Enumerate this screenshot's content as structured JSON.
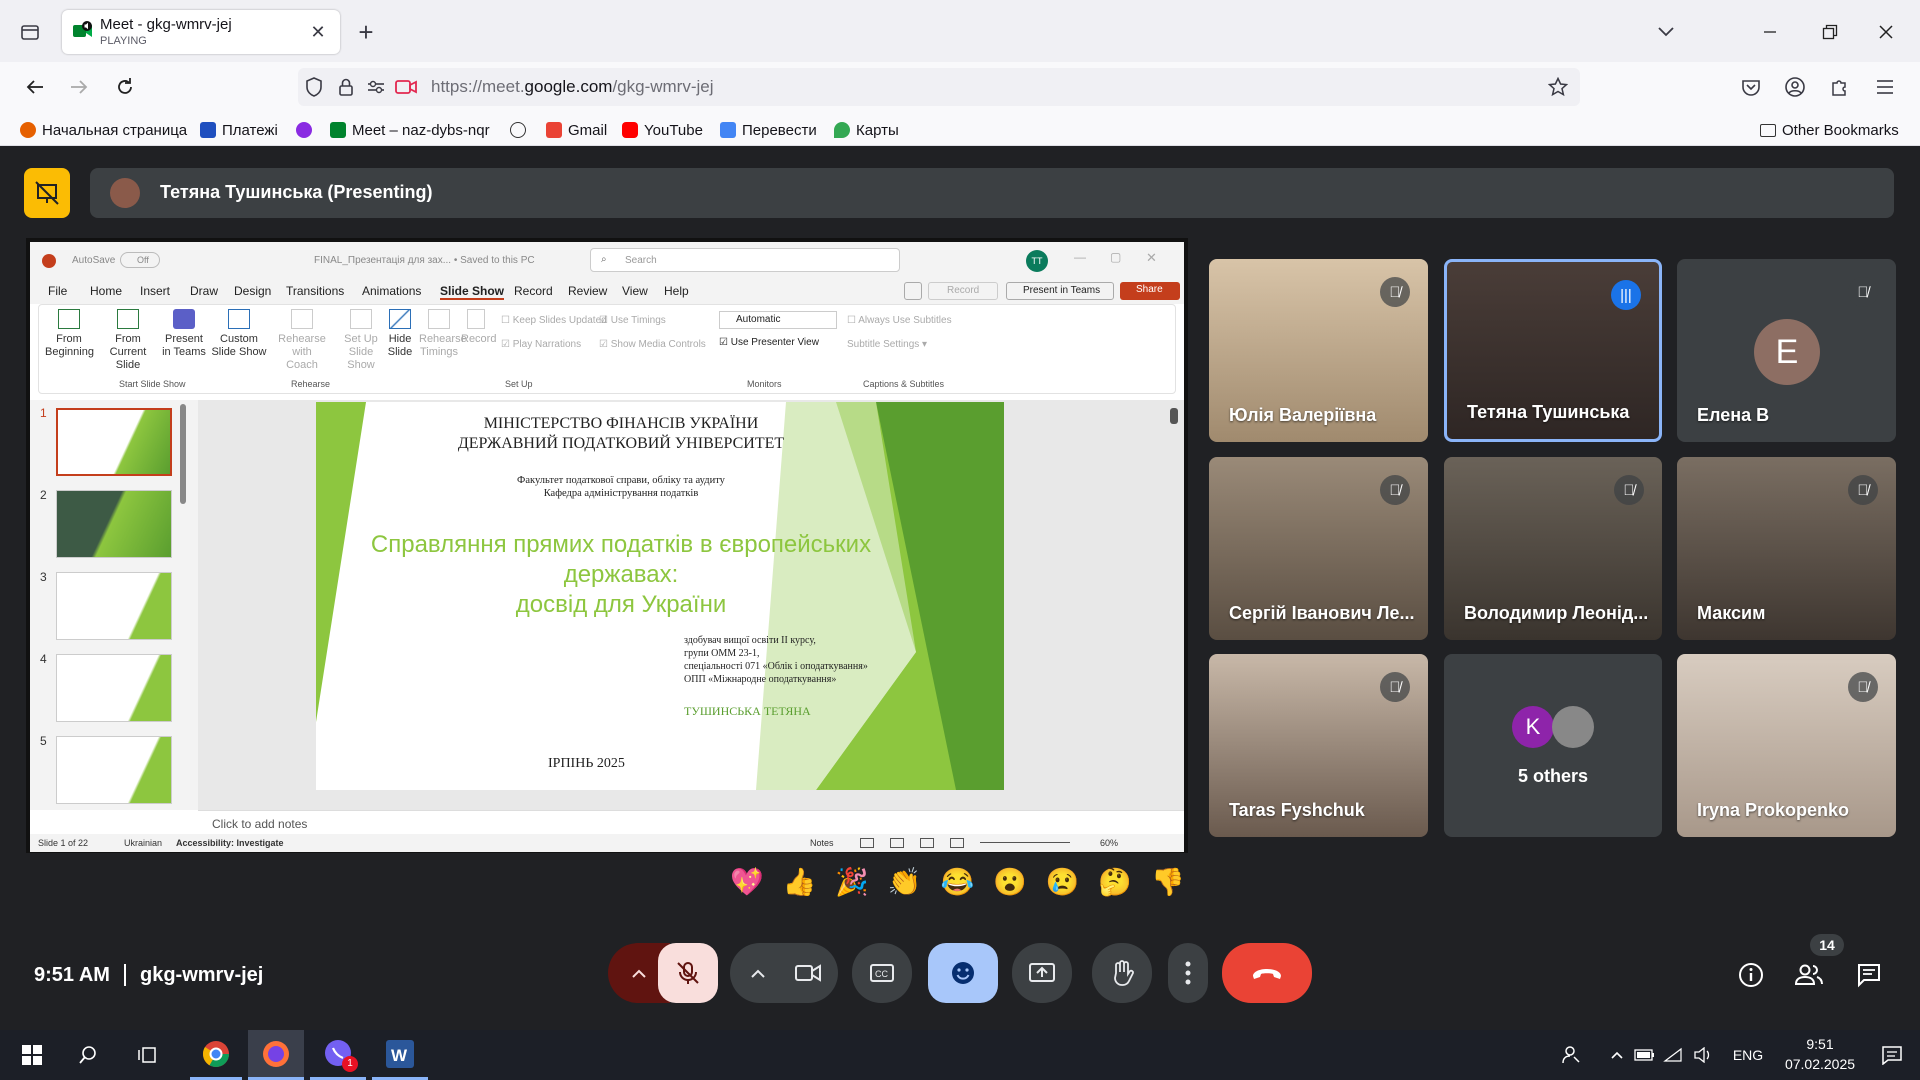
{
  "browser": {
    "tab": {
      "title": "Meet - gkg-wmrv-jej",
      "subtitle": "PLAYING"
    },
    "url": {
      "prefix": "https://meet.",
      "domain": "google.com",
      "path": "/gkg-wmrv-jej"
    },
    "bookmarks": [
      {
        "label": "Начальная страница",
        "color": "#e66000"
      },
      {
        "label": "Платежі",
        "color": "#1f4fbf"
      },
      {
        "label": "Meet – naz-dybs-nqr",
        "color": "#00832d"
      },
      {
        "label": "Gmail",
        "color": "#ea4335"
      },
      {
        "label": "YouTube",
        "color": "#ff0000"
      },
      {
        "label": "Перевести",
        "color": "#4285f4"
      },
      {
        "label": "Карты",
        "color": "#34a853"
      }
    ],
    "other_bookmarks": "Other Bookmarks"
  },
  "meet": {
    "presenter_label": "Тетяна Тушинська (Presenting)",
    "participants": [
      {
        "name": "Юлія Валеріївна",
        "muted": true,
        "bg": "#b8a48c"
      },
      {
        "name": "Тетяна Тушинська",
        "muted": false,
        "speaking": true,
        "bg": "#3a3330"
      },
      {
        "name": "Елена В",
        "muted": true,
        "avatar": "E",
        "bg": "#3c4043",
        "avatar_color": "#8d6e63"
      },
      {
        "name": "Сергій Іванович Ле...",
        "muted": true,
        "bg": "#8a7a6a"
      },
      {
        "name": "Володимир Леонід...",
        "muted": true,
        "bg": "#5a5248"
      },
      {
        "name": "Максим",
        "muted": true,
        "bg": "#6b5e54"
      },
      {
        "name": "Taras Fyshchuk",
        "muted": true,
        "bg": "#7a6a5e"
      },
      {
        "name": "5 others",
        "avatar": "K",
        "bg": "#3c4043",
        "avatar_color": "#8e24aa"
      },
      {
        "name": "Iryna Prokopenko",
        "muted": true,
        "bg": "#a89888"
      }
    ],
    "emojis": [
      "💖",
      "👍",
      "🎉",
      "👏",
      "😂",
      "😮",
      "😢",
      "🤔",
      "👎"
    ],
    "time": "9:51 AM",
    "meeting_code": "gkg-wmrv-jej",
    "people_count": "14",
    "colors": {
      "accent": "#8ab4f8",
      "hangup": "#ea4335",
      "mic_off": "#f9dedc",
      "present_badge": "#fbbc04"
    }
  },
  "ppt": {
    "autosave": "AutoSave",
    "autosave_state": "Off",
    "file_title": "FINAL_Презентація для зах... • Saved to this PC",
    "search": "Search",
    "user_initials": "TT",
    "tabs": [
      "File",
      "Home",
      "Insert",
      "Draw",
      "Design",
      "Transitions",
      "Animations",
      "Slide Show",
      "Record",
      "Review",
      "View",
      "Help"
    ],
    "record_btn": "Record",
    "present_teams": "Present in Teams",
    "share": "Share",
    "ribbon": {
      "from_beginning": "From Beginning",
      "from_current": "From Current Slide",
      "present_teams": "Present in Teams",
      "custom_show": "Custom Slide Show",
      "rehearse_coach": "Rehearse with Coach",
      "setup_show": "Set Up Slide Show",
      "hide_slide": "Hide Slide",
      "rehearse_timings": "Rehearse Timings",
      "record": "Record",
      "keep_updated": "Keep Slides Updated",
      "use_timings": "Use Timings",
      "play_narrations": "Play Narrations",
      "show_media": "Show Media Controls",
      "monitor": "Automatic",
      "presenter_view": "Use Presenter View",
      "always_subtitles": "Always Use Subtitles",
      "subtitle_settings": "Subtitle Settings",
      "groups": [
        "Start Slide Show",
        "Rehearse",
        "Set Up",
        "Monitors",
        "Captions & Subtitles"
      ]
    },
    "slide_numbers": [
      "1",
      "2",
      "3",
      "4",
      "5"
    ],
    "slide": {
      "line1": "МІНІСТЕРСТВО ФІНАНСІВ УКРАЇНИ",
      "line2": "ДЕРЖАВНИЙ ПОДАТКОВИЙ УНІВЕРСИТЕТ",
      "faculty": "Факультет податкової справи, обліку та аудиту",
      "dept": "Кафедра адміністрування податків",
      "title1": "Справляння прямих податків в європейських",
      "title2": "державах:",
      "title3": "досвід для України",
      "info1": "здобувач вищої освіти II курсу,",
      "info2": "групи ОММ 23-1,",
      "info3": "спеціальності 071 «Облік і оподаткування»",
      "info4": "ОПП «Міжнародне оподаткування»",
      "author": "ТУШИНСЬКА ТЕТЯНА",
      "date": "ІРПІНЬ 2025"
    },
    "notes_placeholder": "Click to add notes",
    "status": {
      "slide_of": "Slide 1 of 22",
      "language": "Ukrainian",
      "accessibility": "Accessibility: Investigate",
      "notes": "Notes",
      "zoom": "60%"
    }
  },
  "taskbar": {
    "lang": "ENG",
    "time": "9:51",
    "date": "07.02.2025",
    "viber_badge": "1"
  }
}
